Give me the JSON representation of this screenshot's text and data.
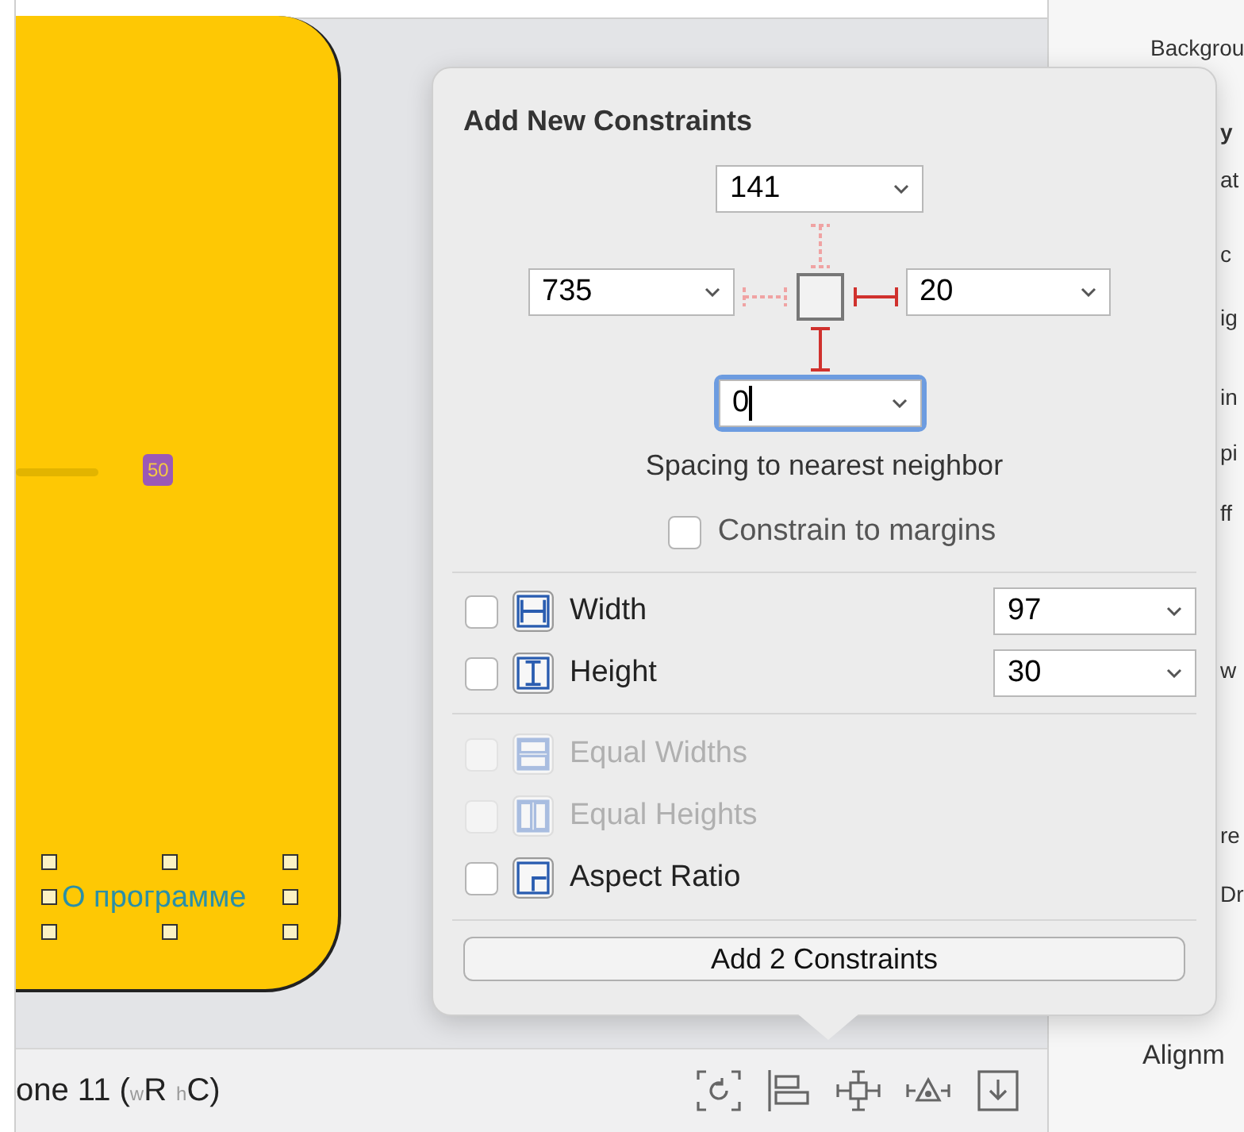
{
  "canvas": {
    "slider_badge": "50",
    "selected_label": {
      "text": "О программе",
      "selected": true
    }
  },
  "device_bar": {
    "prefix": "one 11 (",
    "size_classes": [
      {
        "axis": "w",
        "value": "R"
      },
      {
        "axis": "h",
        "value": "C"
      }
    ],
    "suffix": ")"
  },
  "inspector_fragments": [
    {
      "text": "Backgrou",
      "bold": false
    },
    {
      "text": "y",
      "bold": true
    },
    {
      "text": "at",
      "bold": false
    },
    {
      "text": "c",
      "bold": false
    },
    {
      "text": "ig",
      "bold": false
    },
    {
      "text": "in",
      "bold": false
    },
    {
      "text": "pi",
      "bold": false
    },
    {
      "text": "ff",
      "bold": false
    },
    {
      "text": "w",
      "bold": false
    },
    {
      "text": "re",
      "bold": false
    },
    {
      "text": "Dr",
      "bold": false
    },
    {
      "text": "Alignm",
      "bold": false
    }
  ],
  "popover": {
    "title": "Add New Constraints",
    "spacing": {
      "top": {
        "value": "141",
        "active": false,
        "focused": false
      },
      "left": {
        "value": "735",
        "active": false,
        "focused": false
      },
      "right": {
        "value": "20",
        "active": true,
        "focused": false
      },
      "bottom": {
        "value": "0",
        "active": true,
        "focused": true
      }
    },
    "caption": "Spacing to nearest neighbor",
    "margins": {
      "label": "Constrain to margins",
      "checked": false
    },
    "size_rows": [
      {
        "kind": "width",
        "label": "Width",
        "checked": false,
        "disabled": false,
        "value": "97"
      },
      {
        "kind": "height",
        "label": "Height",
        "checked": false,
        "disabled": false,
        "value": "30"
      }
    ],
    "equal_rows": [
      {
        "kind": "equal-widths",
        "label": "Equal Widths",
        "checked": false,
        "disabled": true
      },
      {
        "kind": "equal-heights",
        "label": "Equal Heights",
        "checked": false,
        "disabled": true
      },
      {
        "kind": "aspect",
        "label": "Aspect Ratio",
        "checked": false,
        "disabled": false
      }
    ],
    "button": "Add 2 Constraints"
  }
}
